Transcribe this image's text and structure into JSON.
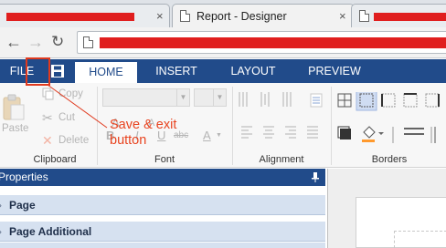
{
  "browser": {
    "active_tab_title": "Report - Designer",
    "close_glyph": "×"
  },
  "ribbon": {
    "tabs": [
      {
        "label": "FILE"
      },
      {
        "label": "HOME"
      },
      {
        "label": "INSERT"
      },
      {
        "label": "LAYOUT"
      },
      {
        "label": "PREVIEW"
      }
    ],
    "active_tab": "HOME",
    "clipboard": {
      "paste": "Paste",
      "copy": "Copy",
      "cut": "Cut",
      "delete": "Delete",
      "group_label": "Clipboard"
    },
    "font": {
      "bold": "B",
      "italic": "I",
      "underline": "U",
      "strike": "abc",
      "color": "A",
      "group_label": "Font"
    },
    "alignment": {
      "group_label": "Alignment"
    },
    "borders": {
      "group_label": "Borders"
    }
  },
  "annotation": {
    "text": "Save & exit\nbutton",
    "color": "#e8431f"
  },
  "properties": {
    "header": "Properties",
    "sections": [
      "Page",
      "Page Additional"
    ]
  },
  "colors": {
    "ribbon_blue": "#214b8a",
    "redaction": "#e01e1e",
    "section_bg": "#d6e1f0"
  }
}
